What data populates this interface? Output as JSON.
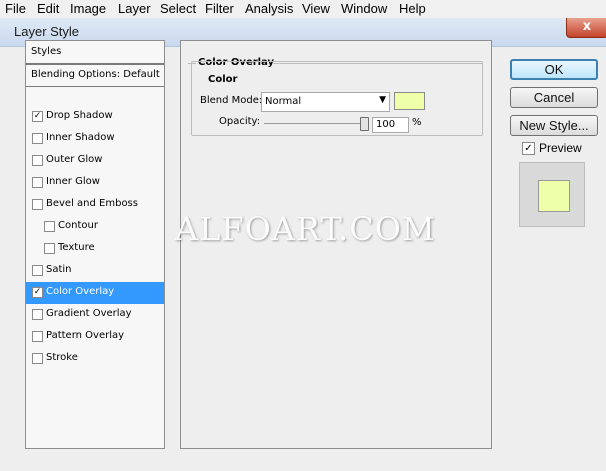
{
  "menu": [
    "File",
    "Edit",
    "Image",
    "Layer",
    "Select",
    "Filter",
    "Analysis",
    "View",
    "Window",
    "Help"
  ],
  "dialog": {
    "title": "Layer Style",
    "close_label": "x"
  },
  "styles_panel": {
    "header": "Styles",
    "blending": "Blending Options: Default",
    "items": [
      {
        "label": "Drop Shadow",
        "checked": true,
        "selected": false,
        "indent": false
      },
      {
        "label": "Inner Shadow",
        "checked": false,
        "selected": false,
        "indent": false
      },
      {
        "label": "Outer Glow",
        "checked": false,
        "selected": false,
        "indent": false
      },
      {
        "label": "Inner Glow",
        "checked": false,
        "selected": false,
        "indent": false
      },
      {
        "label": "Bevel and Emboss",
        "checked": false,
        "selected": false,
        "indent": false
      },
      {
        "label": "Contour",
        "checked": false,
        "selected": false,
        "indent": true
      },
      {
        "label": "Texture",
        "checked": false,
        "selected": false,
        "indent": true
      },
      {
        "label": "Satin",
        "checked": false,
        "selected": false,
        "indent": false
      },
      {
        "label": "Color Overlay",
        "checked": true,
        "selected": true,
        "indent": false
      },
      {
        "label": "Gradient Overlay",
        "checked": false,
        "selected": false,
        "indent": false
      },
      {
        "label": "Pattern Overlay",
        "checked": false,
        "selected": false,
        "indent": false
      },
      {
        "label": "Stroke",
        "checked": false,
        "selected": false,
        "indent": false
      }
    ]
  },
  "color_overlay": {
    "section_title": "Color Overlay",
    "group_title": "Color",
    "blend_mode_label": "Blend Mode:",
    "blend_mode_value": "Normal",
    "swatch_color": "#eeffaa",
    "opacity_label": "Opacity:",
    "opacity_value": "100",
    "opacity_unit": "%"
  },
  "buttons": {
    "ok": "OK",
    "cancel": "Cancel",
    "new_style": "New Style..."
  },
  "preview": {
    "label": "Preview",
    "checked": true,
    "color": "#eeffaa"
  },
  "watermark": "ALFOART.COM"
}
